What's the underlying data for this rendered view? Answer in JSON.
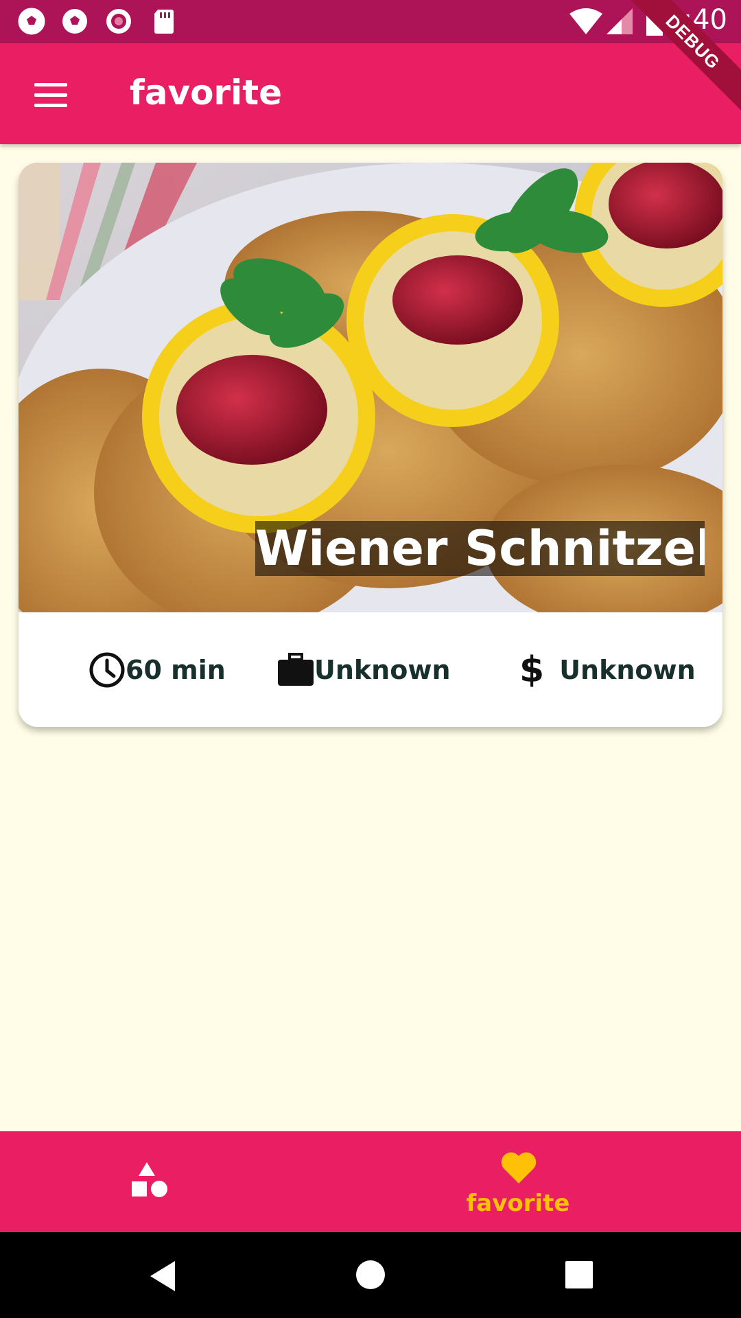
{
  "status_bar": {
    "time": "2:40",
    "left_icons": [
      "soccer-ball-icon",
      "soccer-ball-icon",
      "record-icon",
      "sd-card-icon"
    ],
    "right_icons": [
      "wifi-icon",
      "cell-signal-icon",
      "battery-icon"
    ]
  },
  "debug_banner": "DEBUG",
  "app_bar": {
    "title": "favorite",
    "menu_icon": "menu-icon"
  },
  "meal_card": {
    "title": "Wiener Schnitzel",
    "image": "wiener-schnitzel-photo",
    "duration": "60 min",
    "complexity": "Unknown",
    "affordability": "Unknown"
  },
  "bottom_nav": {
    "items": [
      {
        "icon": "category-icon",
        "label": "",
        "active": false
      },
      {
        "icon": "heart-icon",
        "label": "favorite",
        "active": true
      }
    ],
    "active_color": "#ffc107",
    "inactive_color": "#ffffff"
  },
  "system_nav": [
    "back-icon",
    "home-icon",
    "recents-icon"
  ],
  "colors": {
    "primary": "#e91e63",
    "primary_dark": "#ad1457",
    "accent": "#ffc107",
    "background": "#fffde7"
  }
}
